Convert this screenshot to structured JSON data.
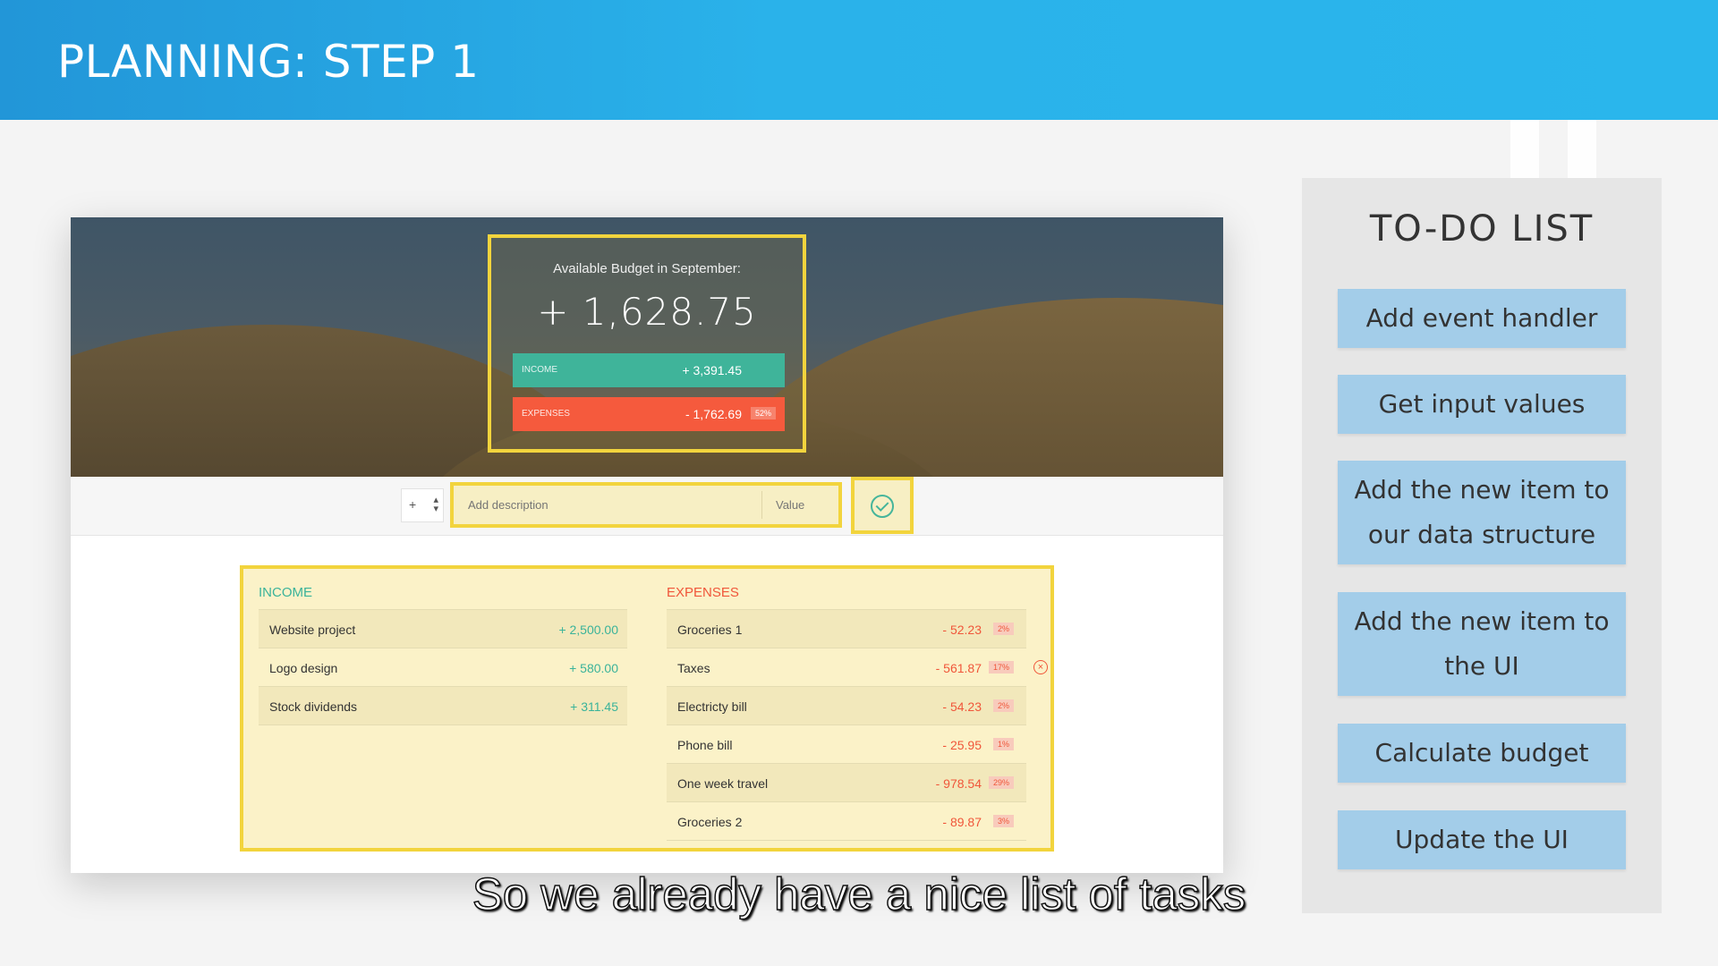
{
  "slide": {
    "title": "PLANNING: STEP 1"
  },
  "app": {
    "budget_title": "Available Budget in September:",
    "budget_value": "+ 1,628.75",
    "income_label": "INCOME",
    "income_total": "+ 3,391.45",
    "expenses_label": "EXPENSES",
    "expenses_total": "- 1,762.69",
    "expenses_pct": "52%",
    "type_symbol": "+",
    "description_placeholder": "Add description",
    "value_placeholder": "Value",
    "income_heading": "INCOME",
    "expenses_heading": "EXPENSES",
    "income_items": [
      {
        "desc": "Website project",
        "value": "+ 2,500.00"
      },
      {
        "desc": "Logo design",
        "value": "+ 580.00"
      },
      {
        "desc": "Stock dividends",
        "value": "+ 311.45"
      }
    ],
    "expense_items": [
      {
        "desc": "Groceries 1",
        "value": "- 52.23",
        "pct": "2%"
      },
      {
        "desc": "Taxes",
        "value": "- 561.87",
        "pct": "17%"
      },
      {
        "desc": "Electricty bill",
        "value": "- 54.23",
        "pct": "2%"
      },
      {
        "desc": "Phone bill",
        "value": "- 25.95",
        "pct": "1%"
      },
      {
        "desc": "One week travel",
        "value": "- 978.54",
        "pct": "29%"
      },
      {
        "desc": "Groceries 2",
        "value": "- 89.87",
        "pct": "3%"
      }
    ]
  },
  "todo": {
    "title": "TO-DO LIST",
    "items": [
      "Add event handler",
      "Get input values",
      "Add the new item to our data structure",
      "Add the new item to the UI",
      "Calculate budget",
      "Update the UI"
    ]
  },
  "caption": "So we already have a nice list of tasks",
  "colors": {
    "header": "#2ab2ea",
    "income": "#3fb49a",
    "expenses": "#f55a3d",
    "highlight": "#f2d43d",
    "todo_item": "#a3cde9"
  }
}
